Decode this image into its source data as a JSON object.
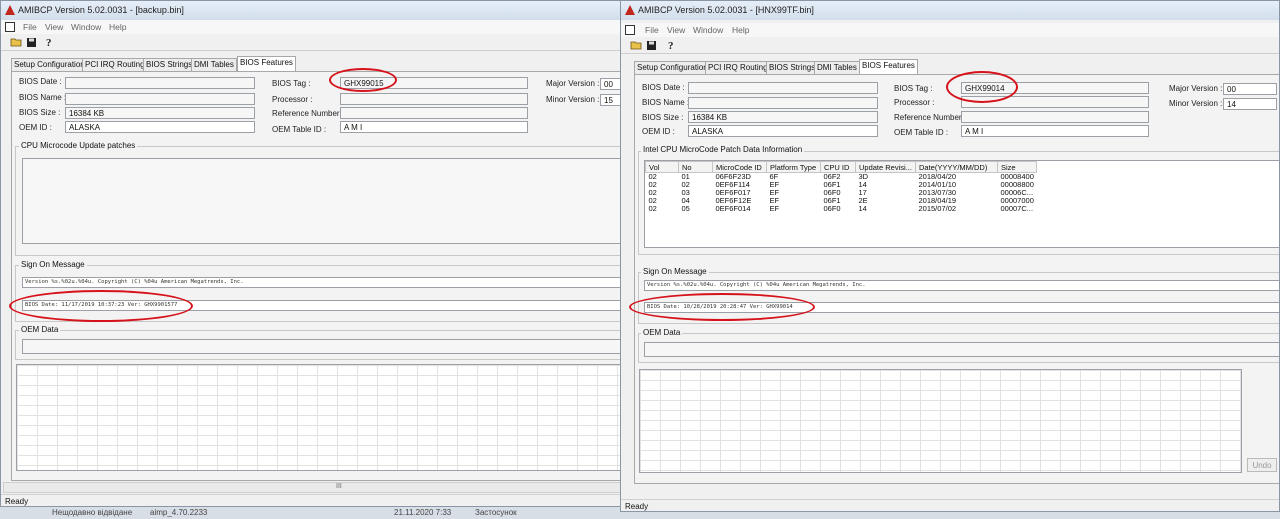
{
  "taskbar": {
    "item1": "Нещодавно відвідане",
    "item2": "aimp_4.70.2233",
    "item3": "21.11.2020 7:33",
    "item4": "Застосунок"
  },
  "menu": {
    "file": "File",
    "view": "View",
    "window": "Window",
    "help": "Help"
  },
  "tabs": [
    "Setup Configuration",
    "PCI IRQ Routing",
    "BIOS Strings",
    "DMI Tables",
    "BIOS Features"
  ],
  "labels": {
    "bios_date": "BIOS Date :",
    "bios_name": "BIOS Name :",
    "bios_size": "BIOS Size :",
    "oem_id": "OEM ID :",
    "bios_tag": "BIOS Tag :",
    "processor": "Processor :",
    "reference_number": "Reference Number :",
    "oem_table_id": "OEM Table ID :",
    "major_version": "Major Version :",
    "minor_version": "Minor Version :",
    "sign_on_message": "Sign On Message",
    "oem_data": "OEM Data",
    "status": "Ready"
  },
  "left": {
    "title": "AMIBCP Version 5.02.0031 - [backup.bin]",
    "bios_size": "16384 KB",
    "oem_id": "ALASKA",
    "bios_tag": "GHX99015",
    "oem_table_id": "A M I",
    "major_version": "00",
    "minor_version": "15",
    "group_title": "CPU Microcode Update patches",
    "sign_on_line1": "Version %s.%02u.%04u. Copyright (C) %04u American Megatrends, Inc.",
    "sign_on_line2": "BIOS Date: 11/17/2019 10:37:23 Ver: GHX9901577",
    "scroll_grip": "III"
  },
  "right": {
    "title": "AMIBCP Version 5.02.0031 - [HNX99TF.bin]",
    "bios_size": "16384 KB",
    "oem_id": "ALASKA",
    "bios_tag": "GHX99014",
    "oem_table_id": "A M I",
    "major_version": "00",
    "minor_version": "14",
    "group_title": "Intel CPU MicroCode Patch Data Information",
    "table_headers": [
      "Vol",
      "No",
      "MicroCode ID",
      "Platform Type",
      "CPU ID",
      "Update Revisi...",
      "Date(YYYY/MM/DD)",
      "Size"
    ],
    "table_rows": [
      [
        "02",
        "01",
        "06F6F23D",
        "6F",
        "06F2",
        "3D",
        "2018/04/20",
        "00008400"
      ],
      [
        "02",
        "02",
        "0EF6F114",
        "EF",
        "06F1",
        "14",
        "2014/01/10",
        "00008800"
      ],
      [
        "02",
        "03",
        "0EF6F017",
        "EF",
        "06F0",
        "17",
        "2013/07/30",
        "00006C..."
      ],
      [
        "02",
        "04",
        "0EF6F12E",
        "EF",
        "06F1",
        "2E",
        "2018/04/19",
        "00007000"
      ],
      [
        "02",
        "05",
        "0EF6F014",
        "EF",
        "06F0",
        "14",
        "2015/07/02",
        "00007C..."
      ]
    ],
    "sign_on_line1": "Version %s.%02u.%04u. Copyright (C) %04u American Megatrends, Inc.",
    "sign_on_line2": "BIOS Date: 10/28/2019 20:28:47 Ver: GHX99014",
    "undo_label": "Undo"
  },
  "colors": {
    "annotation_red": "#d6121a",
    "app_icon_red": "#c0261c"
  },
  "icons": [
    "amibcp-app-icon",
    "open-folder-icon",
    "save-disk-icon",
    "help-icon"
  ]
}
